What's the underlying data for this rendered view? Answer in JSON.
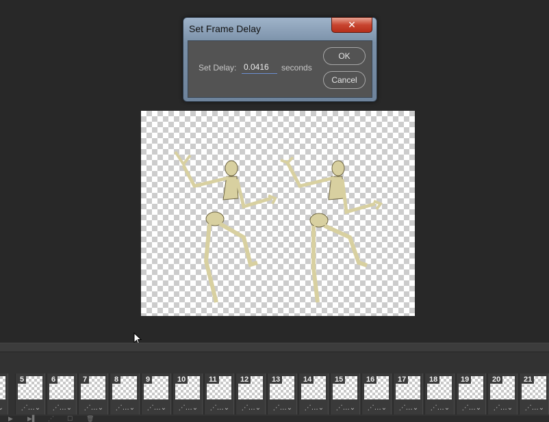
{
  "dialog": {
    "title": "Set Frame Delay",
    "close_glyph": "✕",
    "delay_label": "Set Delay:",
    "delay_value": "0.0416",
    "unit_label": "seconds",
    "ok_label": "OK",
    "cancel_label": "Cancel"
  },
  "timeline": {
    "frames": [
      {
        "num": ""
      },
      {
        "num": "5"
      },
      {
        "num": "6"
      },
      {
        "num": "7"
      },
      {
        "num": "8"
      },
      {
        "num": "9"
      },
      {
        "num": "10"
      },
      {
        "num": "11"
      },
      {
        "num": "12"
      },
      {
        "num": "13"
      },
      {
        "num": "14"
      },
      {
        "num": "15"
      },
      {
        "num": "16"
      },
      {
        "num": "17"
      },
      {
        "num": "18"
      },
      {
        "num": "19"
      },
      {
        "num": "20"
      },
      {
        "num": "21"
      }
    ],
    "frame_footer": "⋰…⌄"
  },
  "colors": {
    "workspace": "#282828",
    "dialog_chrome": "#7a90a8",
    "close_red": "#c8442f",
    "input_underline": "#6b8fd0"
  },
  "icons": [
    "close-icon",
    "mouse-cursor-icon",
    "play-icon",
    "next-frame-icon",
    "new-frame-icon",
    "delete-frame-icon"
  ]
}
